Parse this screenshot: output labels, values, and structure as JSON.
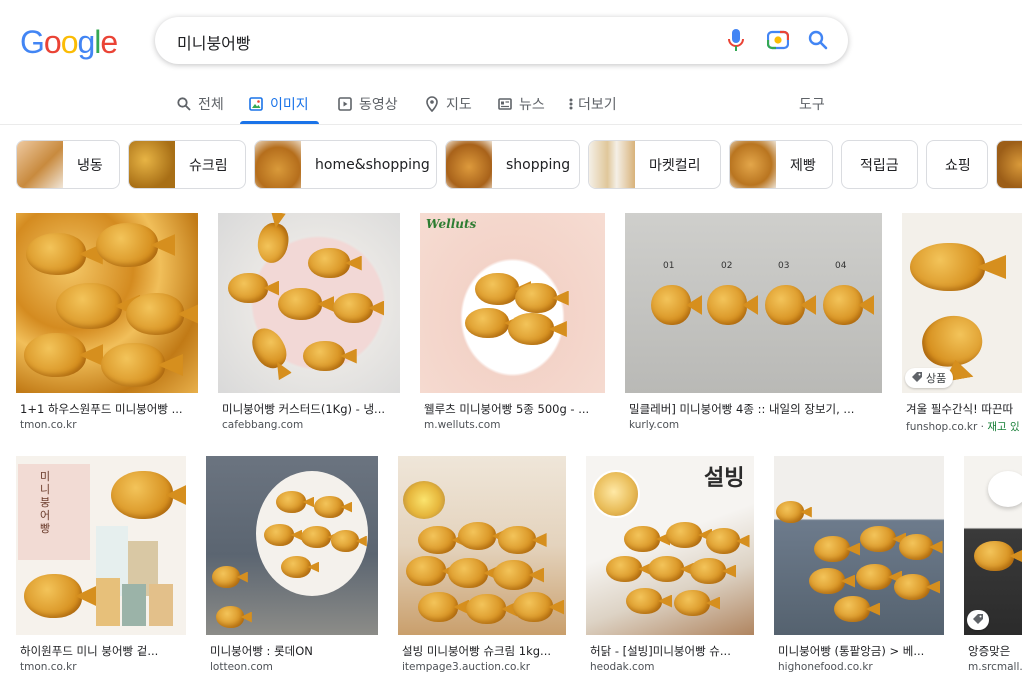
{
  "logo": {
    "text": "Google"
  },
  "search": {
    "query": "미니붕어빵"
  },
  "tabs": [
    {
      "label": "전체",
      "icon": "search-icon"
    },
    {
      "label": "이미지",
      "icon": "image-icon"
    },
    {
      "label": "동영상",
      "icon": "video-icon"
    },
    {
      "label": "지도",
      "icon": "map-pin-icon"
    },
    {
      "label": "뉴스",
      "icon": "news-icon"
    },
    {
      "label": "더보기",
      "icon": "more-vert-icon"
    }
  ],
  "tools_label": "도구",
  "chips": [
    {
      "label": "냉동"
    },
    {
      "label": "슈크림"
    },
    {
      "label": "home&shopping"
    },
    {
      "label": "shopping"
    },
    {
      "label": "마켓컬리"
    },
    {
      "label": "제빵"
    },
    {
      "label": "적립금"
    },
    {
      "label": "쇼핑"
    }
  ],
  "results": [
    {
      "caption": "1+1 하우스원푸드 미니붕어빵 ...",
      "source": "tmon.co.kr"
    },
    {
      "caption": "미니붕어빵 커스터드(1Kg) - 냉...",
      "source": "cafebbang.com"
    },
    {
      "caption": "웰루츠 미니붕어빵 5종 500g - ...",
      "source": "m.welluts.com",
      "overlay": "Welluts"
    },
    {
      "caption": "밀클레버] 미니붕어빵 4종 :: 내일의 장보기, ...",
      "source": "kurly.com",
      "steps": [
        "01",
        "02",
        "03",
        "04"
      ]
    },
    {
      "caption": "겨울 필수간식! 따끈따",
      "source": "funshop.co.kr",
      "badge": "상품",
      "stock": "재고 있"
    },
    {
      "caption": "하이원푸드 미니 붕어빵 겉...",
      "source": "tmon.co.kr",
      "overlay": "미니붕어빵"
    },
    {
      "caption": "미니붕어빵 : 롯데ON",
      "source": "lotteon.com"
    },
    {
      "caption": "설빙 미니붕어빵 슈크림 1kg...",
      "source": "itempage3.auction.co.kr"
    },
    {
      "caption": "허닭 - [설빙]미니붕어빵 슈...",
      "source": "heodak.com",
      "overlay": "설빙"
    },
    {
      "caption": "미니붕어빵 (통팥앙금) > 베...",
      "source": "highonefood.co.kr"
    },
    {
      "caption": "앙증맞은",
      "source": "m.srcmall."
    }
  ],
  "colors": {
    "accent": "#1a73e8",
    "g_blue": "#4285f4",
    "g_red": "#ea4335",
    "g_yellow": "#fbbc05",
    "g_green": "#34a853"
  }
}
